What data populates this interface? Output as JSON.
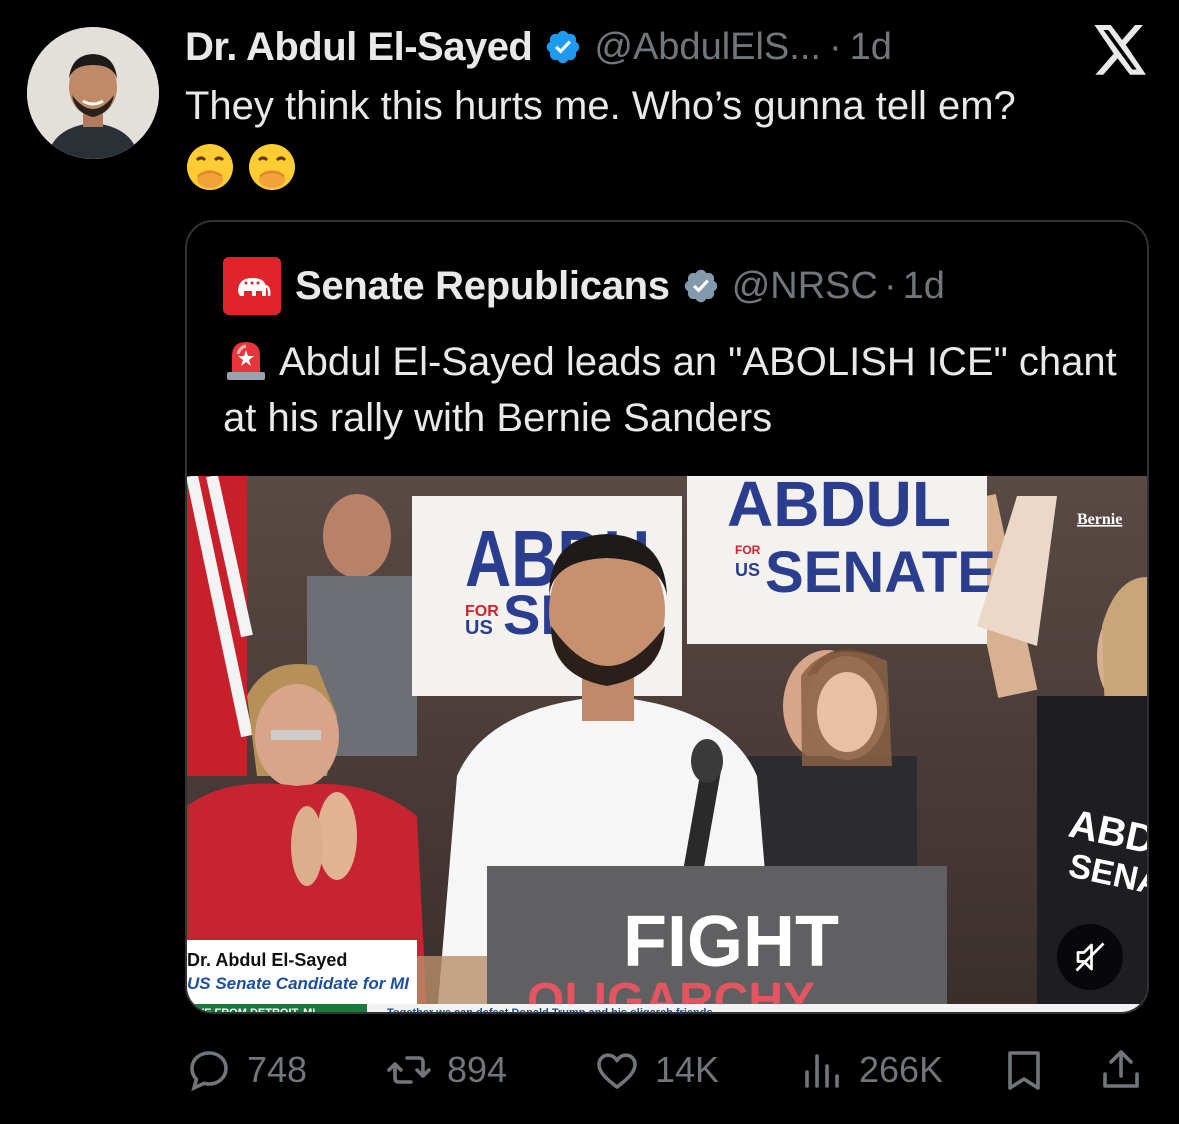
{
  "tweet": {
    "author_name": "Dr. Abdul El-Sayed",
    "handle": "@AbdulElS...",
    "dot": "·",
    "age": "1d",
    "text": "They think this hurts me. Who’s gunna tell em?",
    "emojis": [
      "face-with-hand-over-mouth",
      "face-with-hand-over-mouth"
    ]
  },
  "quote": {
    "author_name": "Senate Republicans",
    "handle": "@NRSC",
    "dot": "·",
    "age": "1d",
    "text": "Abdul El-Sayed leads an \"ABOLISH ICE\" chant at his rally with Bernie Sanders",
    "media": {
      "sign_left_top": "ABDU",
      "sign_left_for": "FOR",
      "sign_left_us": "US",
      "sign_left_bottom": "SEN",
      "sign_right_top": "ABDUL",
      "sign_right_for": "FOR",
      "sign_right_us": "US",
      "sign_right_bottom": "SENATE",
      "podium_text": "FIGHT",
      "podium_sub": "OLIGARCHY",
      "shirt_text_top": "ABD",
      "shirt_text_bottom": "SENA",
      "bernie_logo": "Bernie",
      "lower_third_name": "Dr. Abdul El-Sayed",
      "lower_third_title": "US Senate Candidate for MI",
      "ticker_left": "LIVE FROM DETROIT, MI",
      "ticker_right": "Together we can defeat Donald Trump and his oligarch friends"
    }
  },
  "actions": {
    "replies": "748",
    "reposts": "894",
    "likes": "14K",
    "views": "266K"
  },
  "colors": {
    "background": "#000000",
    "text": "#e7e9ea",
    "muted": "#71767b",
    "verified_blue": "#1d9bf0",
    "nrsc_red": "#e0252a"
  },
  "icons": [
    "x-logo-icon",
    "verified-badge-icon",
    "reply-icon",
    "repost-icon",
    "like-icon",
    "views-icon",
    "bookmark-icon",
    "share-icon",
    "mute-icon",
    "siren-icon"
  ]
}
